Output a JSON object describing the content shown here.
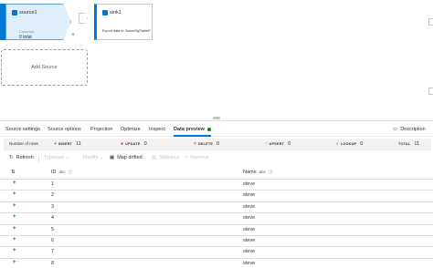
{
  "canvas": {
    "source_node": {
      "title": "source1",
      "columns_label": "Columns:",
      "columns_value": "0 total"
    },
    "sink_node": {
      "title": "sink1",
      "description": "Export data to 'AzureSqlTable0'"
    },
    "add_source_label": "Add Source"
  },
  "tabs": [
    {
      "label": "Source settings"
    },
    {
      "label": "Source options"
    },
    {
      "label": "Projection"
    },
    {
      "label": "Optimize"
    },
    {
      "label": "Inspect"
    },
    {
      "label": "Data preview"
    }
  ],
  "description_button": "Description",
  "stats": {
    "rows_label": "Number of rows",
    "insert_label": "INSERT",
    "insert_value": "11",
    "update_label": "UPDATE",
    "update_value": "0",
    "delete_label": "DELETE",
    "delete_value": "0",
    "upsert_label": "UPSERT",
    "upsert_value": "0",
    "lookup_label": "LOOKUP",
    "lookup_value": "0",
    "total_label": "TOTAL",
    "total_value": "11"
  },
  "toolbar": {
    "refresh": "Refresh",
    "typecast": "Typecast",
    "modify": "Modify",
    "map_drifted": "Map drifted",
    "statistics": "Statistics",
    "remove": "Remove"
  },
  "table": {
    "columns": [
      {
        "name": "ID",
        "type_tag": "abc"
      },
      {
        "name": "Name",
        "type_tag": "abc"
      }
    ],
    "rows": [
      {
        "id": "1",
        "name": "steve"
      },
      {
        "id": "2",
        "name": "steve"
      },
      {
        "id": "3",
        "name": "steve"
      },
      {
        "id": "4",
        "name": "steve"
      },
      {
        "id": "5",
        "name": "steve"
      },
      {
        "id": "6",
        "name": "steve"
      },
      {
        "id": "7",
        "name": "steve"
      },
      {
        "id": "8",
        "name": "steve"
      }
    ]
  },
  "colors": {
    "accent": "#0078d4",
    "insert": "#107c10",
    "update": "#d83b01",
    "delete": "#a4262c",
    "upsert": "#0078d4"
  },
  "icons": [
    "table-icon",
    "refresh-icon",
    "description-icon",
    "sort-icon",
    "insert-icon"
  ]
}
